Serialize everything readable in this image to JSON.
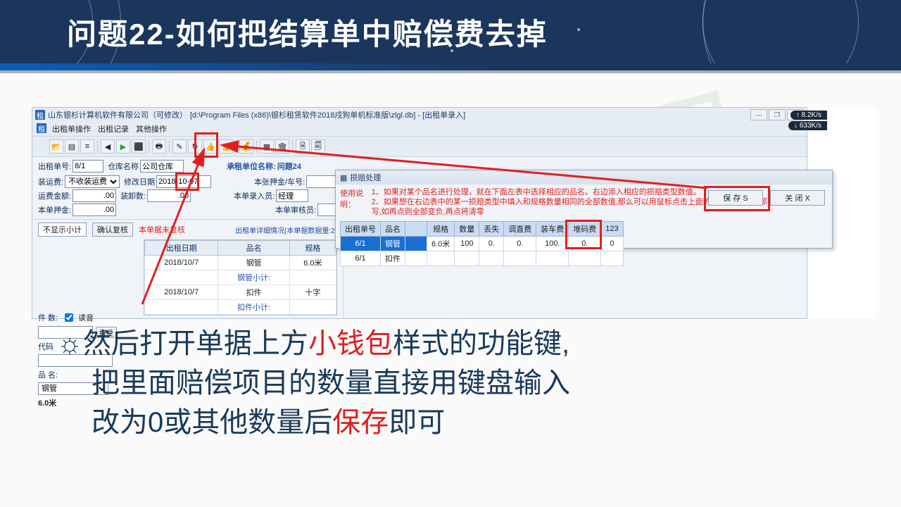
{
  "slide": {
    "title": "问题22-如何把结算单中赔偿费去掉"
  },
  "titlebar": {
    "company": "山东银杉计算机软件有限公司（可修改）",
    "path": "[d:\\Program Files (x86)\\银杉租赁软件2018戌狗单机标准版\\zlgl.db] - [出租单录入]",
    "icon": "租"
  },
  "menu": {
    "m1": "出租单操作",
    "m2": "出租记录",
    "m3": "其他操作"
  },
  "form": {
    "rent_no_label": "出租单号:",
    "rent_no": "8/1",
    "warehouse_label": "仓库名称",
    "warehouse": "公司仓库",
    "ship_label": "装运费:",
    "ship_sel": "不收装运费",
    "mod_date_label": "修改日期",
    "mod_date": "2018-10-07",
    "ship_amount_label": "运费金额:",
    "ship_amount": ".00",
    "load_num_label": "装卸数:",
    "load_num": ".00",
    "deposit_label": "本单押金:",
    "deposit": ".00",
    "renter_label": "承租单位名称:",
    "renter": "问题24",
    "vehicle_label": "本张押金/车号:",
    "entry_label": "本单录入员:",
    "entry": "经理",
    "review_label": "本单审核员:"
  },
  "tabs": {
    "t1": "不显示小计",
    "t2": "确认复核",
    "link": "本单据未复核",
    "detail_link": "出租单详细情况(本单据数据量:2)"
  },
  "lefttbl": {
    "headers": [
      "出租日期",
      "品名",
      "规格"
    ],
    "rows": [
      [
        "2018/10/7",
        "钢管",
        "6.0米"
      ],
      [
        "",
        "钢管小计:",
        ""
      ],
      [
        "2018/10/7",
        "扣件",
        "十字"
      ],
      [
        "",
        "扣件小计:",
        ""
      ]
    ]
  },
  "leftside": {
    "count_label": "件  数:",
    "read_chk": "读音",
    "accept": "接受",
    "code_label": "代码",
    "name_label": "品  名:",
    "name_sel": "钢管",
    "spec": "6.0米"
  },
  "dialog": {
    "title": "损赔处理",
    "help_label": "使用说明：",
    "line1": "1、如果对某个品名进行处理，就在下面左表中选择相应的品名。右边添入相应的损赔类型数值。",
    "line2": "2、如果想在右边表中的某一损赔类型中填入和规格数量相同的全部数值,那么可以用鼠标点击上面的损赔类型名称,那么系统将自动填写,如再点则全部变负,再点将清零",
    "save": "保  存  S",
    "close": "关  闭  X"
  },
  "grid": {
    "headers": [
      "出租单号",
      "品名",
      "规格",
      "数量",
      "丢失",
      "调直费",
      "装车费",
      "堆码费",
      "123"
    ],
    "row1": [
      "6/1",
      "钢管",
      "6.0米",
      "100",
      "0.",
      "0.",
      "100.",
      "0.",
      "0"
    ],
    "row2": [
      "6/1",
      "扣件",
      "",
      "",
      "",
      "",
      "",
      "",
      ""
    ]
  },
  "speeds": {
    "up": "8.2K/s",
    "down": "633K/s"
  },
  "caption": {
    "p1a": "然后打开单据上方",
    "p1b": "小钱包",
    "p1c": "样式的功能键,",
    "p2": "把里面赔偿项目的数量直接用键盘输入",
    "p3a": "改为0或其他数量后",
    "p3b": "保存",
    "p3c": "即可"
  },
  "watermark": "非会员勿用"
}
